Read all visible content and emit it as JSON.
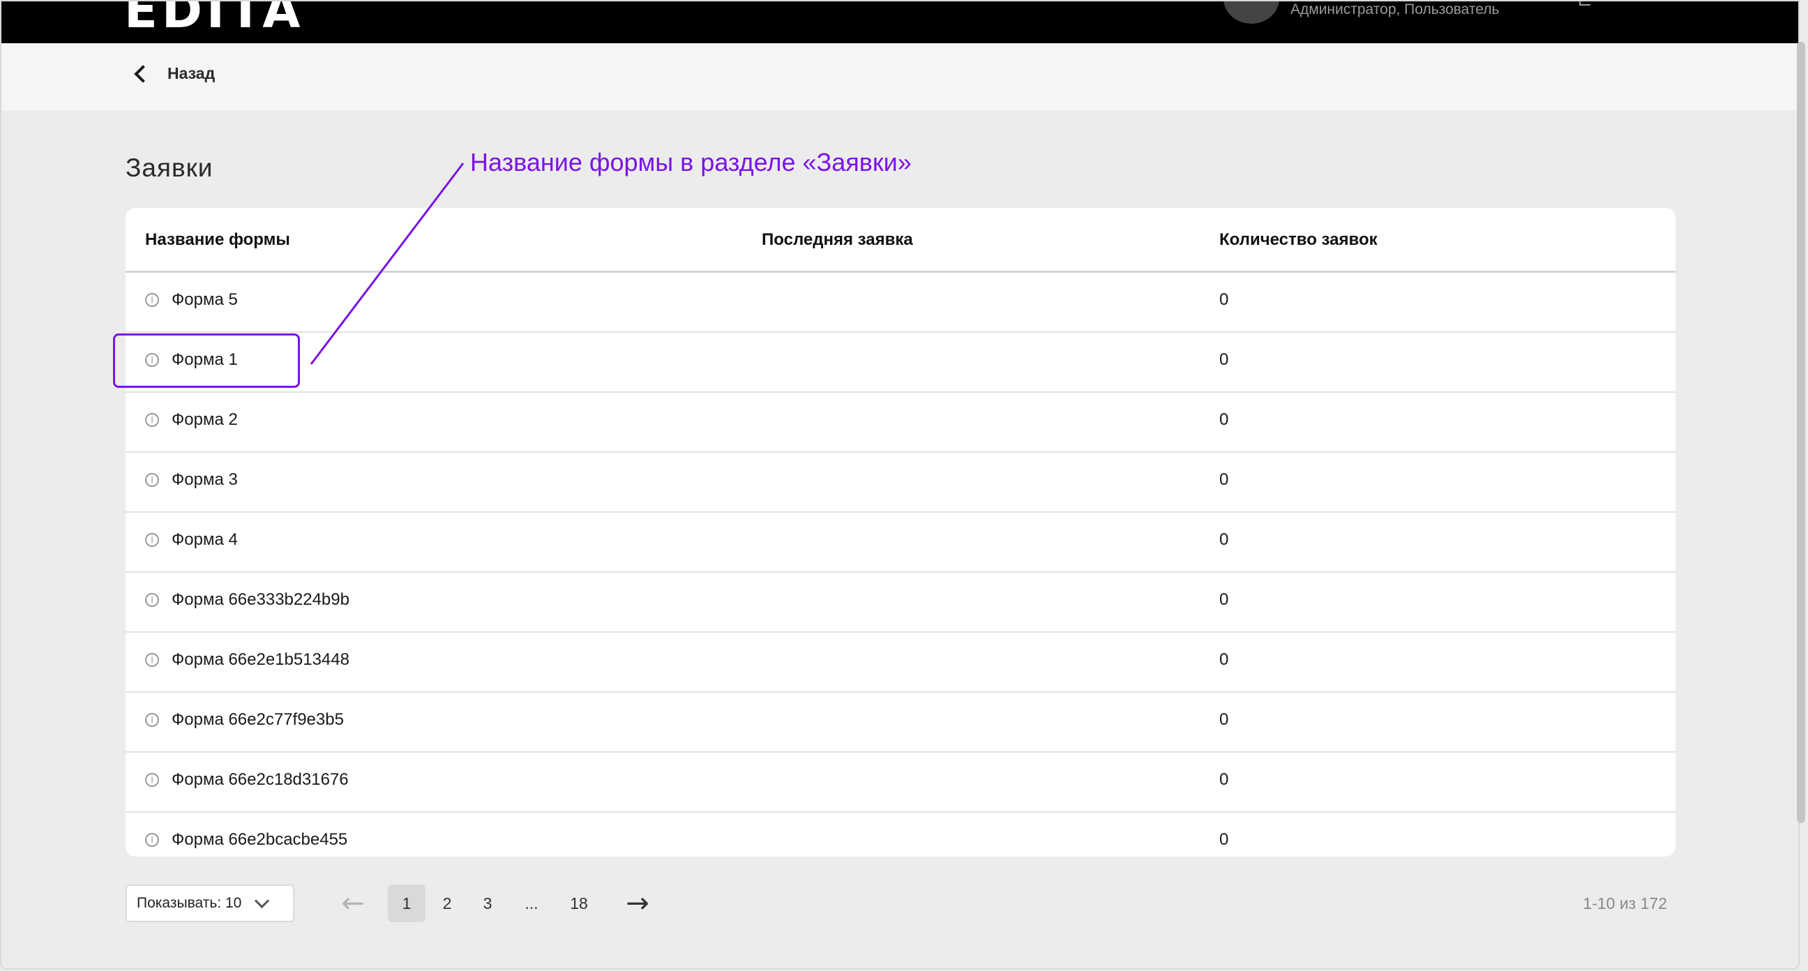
{
  "header": {
    "logo": "EDITA",
    "user_role": "Администратор, Пользователь"
  },
  "nav": {
    "back_label": "Назад"
  },
  "page": {
    "title": "Заявки"
  },
  "table": {
    "columns": [
      "Название формы",
      "Последняя заявка",
      "Количество заявок"
    ],
    "rows": [
      {
        "name": "Форма 5",
        "last": "",
        "count": "0"
      },
      {
        "name": "Форма 1",
        "last": "",
        "count": "0"
      },
      {
        "name": "Форма 2",
        "last": "",
        "count": "0"
      },
      {
        "name": "Форма 3",
        "last": "",
        "count": "0"
      },
      {
        "name": "Форма 4",
        "last": "",
        "count": "0"
      },
      {
        "name": "Форма 66e333b224b9b",
        "last": "",
        "count": "0"
      },
      {
        "name": "Форма 66e2e1b513448",
        "last": "",
        "count": "0"
      },
      {
        "name": "Форма 66e2c77f9e3b5",
        "last": "",
        "count": "0"
      },
      {
        "name": "Форма 66e2c18d31676",
        "last": "",
        "count": "0"
      },
      {
        "name": "Форма 66e2bcacbe455",
        "last": "",
        "count": "0"
      }
    ]
  },
  "annotation": {
    "text": "Название формы в разделе «Заявки»",
    "color": "#7a14e8"
  },
  "pagination": {
    "page_size_label": "Показывать: 10",
    "pages": [
      "1",
      "2",
      "3",
      "...",
      "18"
    ],
    "current": "1",
    "prev_icon": "arrow-left-icon",
    "next_icon": "arrow-right-icon",
    "range_text": "1-10 из 172"
  }
}
